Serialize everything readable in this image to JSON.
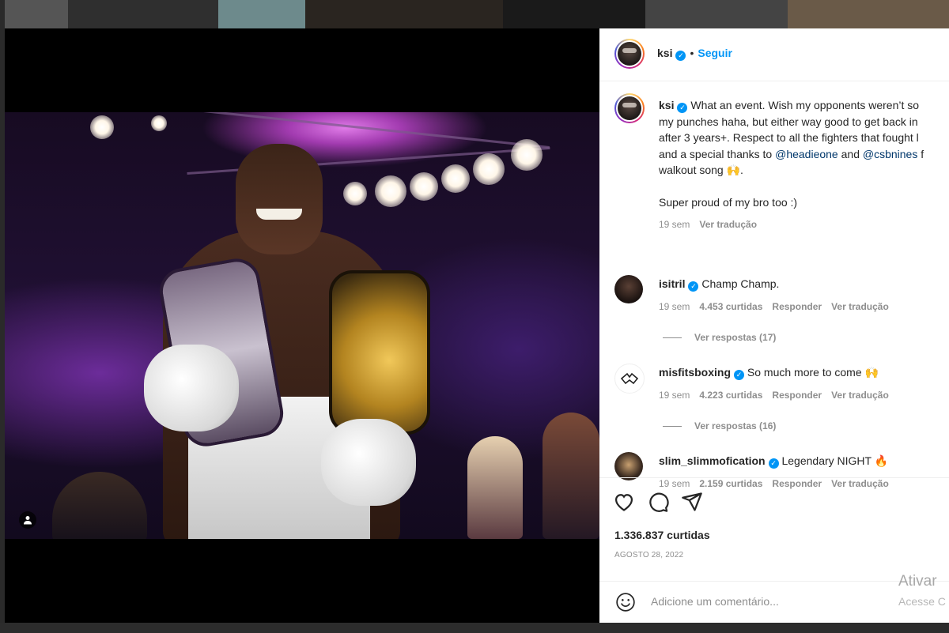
{
  "post": {
    "username": "ksi",
    "follow_label": "Seguir",
    "caption_lines": [
      "What an event. Wish my opponents weren’t so",
      "my punches haha, but either way good to get back in",
      "after 3 years+. Respect to all the fighters that fought l",
      "and a special thanks to @headieone and @csbnines f",
      "walkout song 🙌."
    ],
    "caption_prefix": "and a special thanks to ",
    "mention1": "@headieone",
    "caption_and": " and ",
    "mention2": "@csbnines",
    "caption_suffix": " f",
    "caption_extra": "Super proud of my bro too :)",
    "caption_time": "19 sem",
    "caption_translate": "Ver tradução",
    "likes": "1.336.837 curtidas",
    "date": "AGOSTO 28, 2022",
    "comment_placeholder": "Adicione um comentário..."
  },
  "comments": [
    {
      "username": "isitril",
      "text": "Champ Champ.",
      "time": "19 sem",
      "likes": "4.453 curtidas",
      "reply": "Responder",
      "translate": "Ver tradução",
      "replies": "Ver respostas (17)"
    },
    {
      "username": "misfitsboxing",
      "text": "So much more to come 🙌",
      "time": "19 sem",
      "likes": "4.223 curtidas",
      "reply": "Responder",
      "translate": "Ver tradução",
      "replies": "Ver respostas (16)"
    },
    {
      "username": "slim_slimmofication",
      "text": "Legendary NIGHT 🔥",
      "time": "19 sem",
      "likes": "2.159 curtidas",
      "reply": "Responder",
      "translate": "Ver tradução"
    }
  ],
  "watermark": {
    "line1": "Ativar",
    "line2": "Acesse C"
  },
  "icons": {
    "verified": "verified-badge-icon",
    "like": "heart-icon",
    "comment": "comment-bubble-icon",
    "share": "paper-plane-icon",
    "emoji": "emoji-smile-icon",
    "tag": "user-tag-icon"
  },
  "colors": {
    "accent": "#0095f6",
    "mention": "#00376b",
    "text": "#262626",
    "muted": "#8e8e8e"
  }
}
